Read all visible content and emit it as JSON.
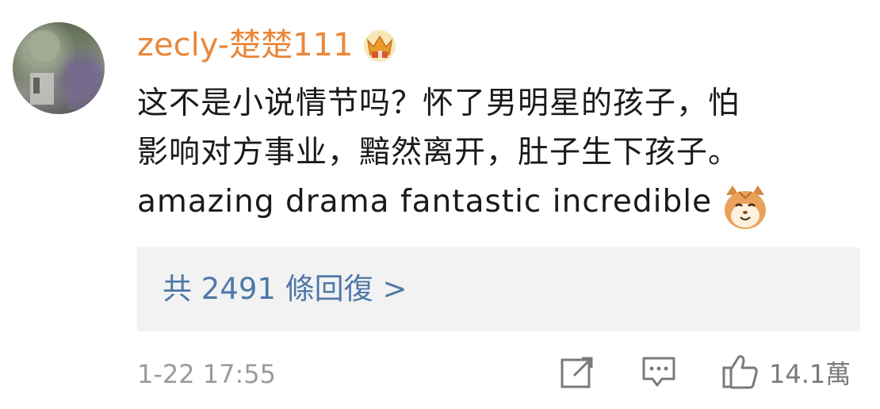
{
  "user": {
    "name": "zecly-楚楚111",
    "badge_icon": "crown-badge-icon",
    "name_color": "#e8873a"
  },
  "comment": {
    "line1": "这不是小说情节吗？怀了男明星的孩子，怕",
    "line2": "影响对方事业，黯然离开，肚子生下孩子。",
    "line3": "amazing drama fantastic incredible",
    "emoji": "cat-face-emoji"
  },
  "replies": {
    "label": "共 2491 條回復 >",
    "color": "#4f78a8"
  },
  "meta": {
    "timestamp": "1-22 17:55",
    "like_count": "14.1萬"
  },
  "actions": {
    "share_icon": "share-icon",
    "reply_icon": "comment-icon",
    "like_icon": "thumbs-up-icon"
  }
}
